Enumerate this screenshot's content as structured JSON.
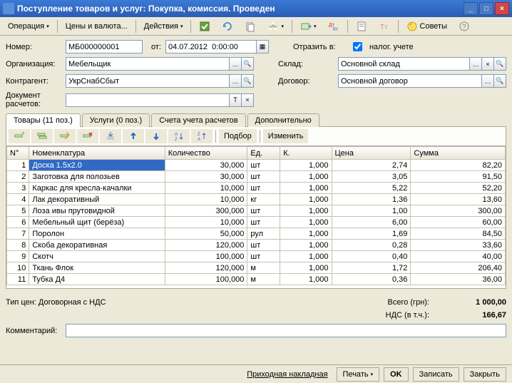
{
  "window": {
    "title": "Поступление товаров и услуг: Покупка, комиссия. Проведен"
  },
  "toolbar": {
    "operation": "Операция",
    "prices": "Цены и валюта...",
    "actions": "Действия",
    "advice": "Советы"
  },
  "form": {
    "number_label": "Номер:",
    "number": "МБ000000001",
    "from_label": "от:",
    "date": "04.07.2012  0:00:00",
    "reflect_label": "Отразить в:",
    "tax_account": "налог. учете",
    "org_label": "Организация:",
    "org": "Мебельщик",
    "warehouse_label": "Склад:",
    "warehouse": "Основной склад",
    "counterparty_label": "Контрагент:",
    "counterparty": "УкрСнабСбыт",
    "contract_label": "Договор:",
    "contract": "Основной договор",
    "doc_label": "Документ расчетов:"
  },
  "tabs": {
    "goods": "Товары (11 поз.)",
    "services": "Услуги (0 поз.)",
    "accounts": "Счета учета расчетов",
    "extra": "Дополнительно"
  },
  "tab_tb": {
    "select": "Подбор",
    "change": "Изменить"
  },
  "grid": {
    "headers": {
      "n": "N°",
      "nom": "Номенклатура",
      "qty": "Количество",
      "unit": "Ед.",
      "k": "К.",
      "price": "Цена",
      "sum": "Сумма"
    },
    "rows": [
      {
        "n": "1",
        "nom": "Доска 1.5x2.0",
        "qty": "30,000",
        "unit": "шт",
        "k": "1,000",
        "price": "2,74",
        "sum": "82,20"
      },
      {
        "n": "2",
        "nom": "Заготовка для полозьев",
        "qty": "30,000",
        "unit": "шт",
        "k": "1,000",
        "price": "3,05",
        "sum": "91,50"
      },
      {
        "n": "3",
        "nom": "Каркас для кресла-качалки",
        "qty": "10,000",
        "unit": "шт",
        "k": "1,000",
        "price": "5,22",
        "sum": "52,20"
      },
      {
        "n": "4",
        "nom": "Лак декоративный",
        "qty": "10,000",
        "unit": "кг",
        "k": "1,000",
        "price": "1,36",
        "sum": "13,60"
      },
      {
        "n": "5",
        "nom": "Лоза ивы прутовидной",
        "qty": "300,000",
        "unit": "шт",
        "k": "1,000",
        "price": "1,00",
        "sum": "300,00"
      },
      {
        "n": "6",
        "nom": "Мебельный щит (берёза)",
        "qty": "10,000",
        "unit": "шт",
        "k": "1,000",
        "price": "6,00",
        "sum": "60,00"
      },
      {
        "n": "7",
        "nom": "Поролон",
        "qty": "50,000",
        "unit": "рул",
        "k": "1,000",
        "price": "1,69",
        "sum": "84,50"
      },
      {
        "n": "8",
        "nom": "Скоба декоративная",
        "qty": "120,000",
        "unit": "шт",
        "k": "1,000",
        "price": "0,28",
        "sum": "33,60"
      },
      {
        "n": "9",
        "nom": "Скотч",
        "qty": "100,000",
        "unit": "шт",
        "k": "1,000",
        "price": "0,40",
        "sum": "40,00"
      },
      {
        "n": "10",
        "nom": "Ткань Флок",
        "qty": "120,000",
        "unit": "м",
        "k": "1,000",
        "price": "1,72",
        "sum": "206,40"
      },
      {
        "n": "11",
        "nom": "Тубка Д4",
        "qty": "100,000",
        "unit": "м",
        "k": "1,000",
        "price": "0,36",
        "sum": "36,00"
      }
    ]
  },
  "totals": {
    "price_type_label": "Тип цен:",
    "price_type": "Договорная с НДС",
    "total_label": "Всего (грн):",
    "total": "1 000,00",
    "vat_label": "НДС (в т.ч.):",
    "vat": "166,67"
  },
  "comment_label": "Комментарий:",
  "footer": {
    "invoice": "Приходная накладная",
    "print": "Печать",
    "ok": "OK",
    "save": "Записать",
    "close": "Закрыть"
  }
}
